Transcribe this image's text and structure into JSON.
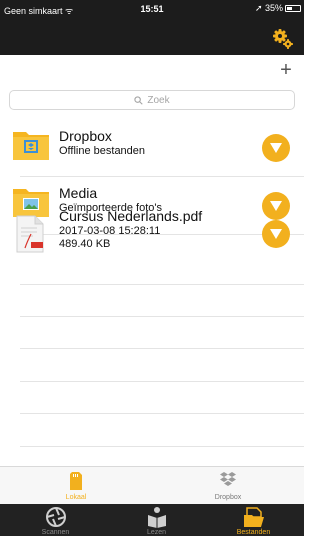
{
  "status_bar": {
    "carrier": "Geen simkaart ᯤ",
    "time": "15:51",
    "battery": "➚ 35%"
  },
  "toolbar": {
    "add_label": "+"
  },
  "search": {
    "placeholder": "Zoek"
  },
  "files": [
    {
      "title": "Dropbox",
      "lines": [
        "Offline bestanden"
      ]
    },
    {
      "title": "Media",
      "lines": [
        "Geïmporteerde foto's"
      ]
    },
    {
      "title": "Cursus Nederlands.pdf",
      "lines": [
        "2017-03-08 15:28:11",
        "489.40 KB"
      ]
    }
  ],
  "tabs": {
    "local": "Lokaal",
    "dropbox": "Dropbox"
  },
  "bottom_nav": {
    "scan": "Scannen",
    "read": "Lezen",
    "files": "Bestanden"
  },
  "colors": {
    "accent": "#f2b01e",
    "bar": "#1c1c1c",
    "folder": "#f5b520"
  }
}
